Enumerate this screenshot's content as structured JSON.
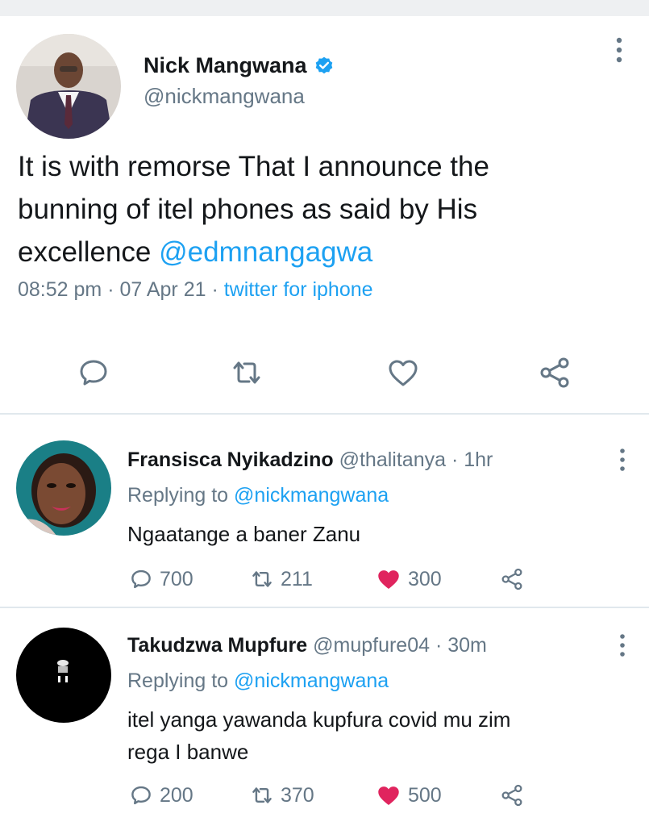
{
  "main_tweet": {
    "author_name": "Nick Mangwana",
    "author_handle": "@nickmangwana",
    "text_line1": "It is with remorse That I announce the",
    "text_line2": "bunning of itel phones as said by His",
    "text_line3_prefix": "excellence ",
    "text_mention": "@edmnangagwa",
    "time": "08:52 pm",
    "date": "07 Apr 21",
    "source": "twitter for iphone",
    "sep": " · ",
    "icons": [
      "reply-icon",
      "retweet-icon",
      "like-icon",
      "share-icon"
    ]
  },
  "replies": [
    {
      "name": "Fransisca Nyikadzino",
      "handle": "@thalitanya",
      "time": "1hr",
      "replying_prefix": "Replying to ",
      "replying_handle": "@nickmangwana",
      "text": "Ngaatange a baner Zanu",
      "reply_count": "700",
      "retweet_count": "211",
      "like_count": "300"
    },
    {
      "name": "Takudzwa Mupfure",
      "handle": "@mupfure04",
      "time": "30m",
      "replying_prefix": "Replying to ",
      "replying_handle": "@nickmangwana",
      "text_line1": "itel yanga yawanda kupfura covid mu zim",
      "text_line2": "rega I banwe",
      "reply_count": "200",
      "retweet_count": "370",
      "like_count": "500"
    }
  ],
  "colors": {
    "accent": "#1da1f2",
    "muted": "#657786",
    "like": "#e0245e",
    "text": "#14171a"
  }
}
